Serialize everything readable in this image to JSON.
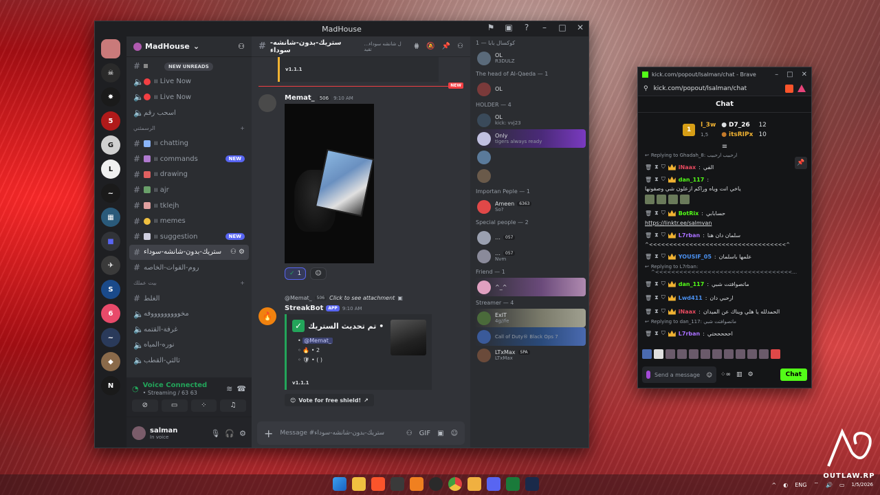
{
  "discord": {
    "window_title": "MadHouse",
    "guild_name": "MadHouse",
    "new_unreads": "NEW UNREADS",
    "channels": [
      {
        "label": "ıı Live Now",
        "badge": ""
      },
      {
        "label": "ıı Live Now",
        "badge": ""
      },
      {
        "label": "اسحب رقم",
        "badge": ""
      }
    ],
    "category1": "الرسمثني",
    "channels2": [
      {
        "label": "ıı chatting",
        "badge": "",
        "color": "#8ab4f8"
      },
      {
        "label": "ıı commands",
        "badge": "NEW",
        "color": "#b07ad0"
      },
      {
        "label": "ıı drawing",
        "badge": "",
        "color": "#e06060"
      },
      {
        "label": "ıı ajr",
        "badge": "",
        "color": "#6aa06a"
      },
      {
        "label": "ıı tklejh",
        "badge": "",
        "color": "#e0a0a0"
      },
      {
        "label": "ıı memes",
        "badge": "",
        "color": "#f0c040"
      },
      {
        "label": "ıı suggestion",
        "badge": "NEW",
        "color": "#d0d0e0"
      },
      {
        "label": "ستريك-بدون-شانشه-سوداء",
        "badge": "",
        "color": ""
      },
      {
        "label": "روم-القوات-الخاصه",
        "badge": "",
        "color": ""
      }
    ],
    "category2": "بيت عملك",
    "channels3": [
      {
        "label": "الغلط"
      },
      {
        "label": "مخوووووووووفه"
      },
      {
        "label": "غرفة-القتمه"
      },
      {
        "label": "نوره-المياه"
      },
      {
        "label": "ثالثي-القطب"
      }
    ],
    "voice": {
      "title": "Voice Connected",
      "sub": "• Streaming / 63 63"
    },
    "user": {
      "name": "salman",
      "status": "In voice"
    },
    "chat_header": {
      "channel": "ستريك-بدون-شانشه-سوداء",
      "topic": "…ل شانشه سوداء تقيد"
    },
    "version_text": "v1.1.1",
    "new_label": "NEW",
    "message1": {
      "author": "Memat_",
      "badge": "506",
      "time": "9:10 AM"
    },
    "reaction": {
      "emoji": "✓",
      "count": "1"
    },
    "reply": {
      "user": "@Memat_",
      "badge": "506",
      "text": "Click to see attachment"
    },
    "bot": {
      "author": "StreakBot",
      "app_tag": "APP",
      "time": "9:10 AM"
    },
    "embed": {
      "title": "تم تحديث الستريك •",
      "mention": "@Memat_",
      "line1": "• 2",
      "line2": "• (   )",
      "version": "v1.1.1"
    },
    "vote_label": "Vote for free shield!",
    "composer_placeholder": "Message #ستريك-بدون-شانشه-سوداء",
    "member_groups": [
      {
        "title": "كوكسال بابا — 1",
        "members": [
          {
            "name": "OL",
            "sub": "R3DULZ",
            "tag": "",
            "style": ""
          }
        ]
      },
      {
        "title": "The head of Al-Qaeda — 1",
        "members": [
          {
            "name": "OL",
            "sub": "",
            "tag": "",
            "style": ""
          }
        ]
      },
      {
        "title": "HOLDER — 4",
        "members": [
          {
            "name": "OL",
            "sub": "kick: vvj23",
            "tag": "",
            "style": ""
          },
          {
            "name": "Only",
            "sub": "tigers always ready",
            "tag": "",
            "style": "hl"
          },
          {
            "name": "",
            "sub": "",
            "tag": "",
            "style": ""
          },
          {
            "name": "",
            "sub": "",
            "tag": "",
            "style": ""
          }
        ]
      },
      {
        "title": "Importan Peple — 1",
        "members": [
          {
            "name": "Ameen",
            "sub": "So?",
            "tag": "6363",
            "style": ""
          }
        ]
      },
      {
        "title": "Special people — 2",
        "members": [
          {
            "name": "…",
            "sub": "",
            "tag": "057",
            "style": ""
          },
          {
            "name": "…",
            "sub": "Nvm",
            "tag": "057",
            "style": ""
          }
        ]
      },
      {
        "title": "Friend — 1",
        "members": [
          {
            "name": "^_^",
            "sub": "",
            "tag": "",
            "style": "hl2"
          }
        ]
      },
      {
        "title": "Streamer — 4",
        "members": [
          {
            "name": "ExIT",
            "sub": "4g//fe",
            "tag": "",
            "style": "hl3"
          },
          {
            "name": "",
            "sub": "Call of Duty® Black Ops 7",
            "tag": "",
            "style": "hl4"
          },
          {
            "name": "LTxMax",
            "sub": "LTxMax",
            "tag": "SPA",
            "style": ""
          }
        ]
      }
    ]
  },
  "kick": {
    "window_title": "kick.com/popout/lsalman/chat - Brave",
    "url": "kick.com/popout/lsalman/chat",
    "header": "Chat",
    "leaders": {
      "first": "l_3w",
      "first_count": "1,5",
      "second": "D7_26",
      "second_count": "12",
      "third": "itsRIPx",
      "third_count": "10"
    },
    "messages": [
      {
        "reply": "Replying to Ghadah_8: ارحبيب ارحبيب",
        "user": "iNaax",
        "color": "#e84a5f",
        "text": "الفي"
      },
      {
        "reply": "",
        "user": "dan_117",
        "color": "#53fc18",
        "text": "ياخي انت وياه وراكم ازعلون شي وصفونها",
        "emotes": 4
      },
      {
        "reply": "",
        "user": "BotRix",
        "color": "#53fc18",
        "text": "حسابابي",
        "link": "https://linktr.ee/salmvan"
      },
      {
        "reply": "",
        "user": "L7rban",
        "color": "#a970ff",
        "text": "سلمان دان هنا",
        "extra": "^<<<<<<<<<<<<<<<<<<<<<<<<<<<<<<<<<<^"
      },
      {
        "reply": "",
        "user": "YOUSIF_05",
        "color": "#4a90f0",
        "text": "علمها باسلمان"
      },
      {
        "reply": "Replying to L7rban: ^<<<<<<<<<<<<<<<<<<<<<<<<<<<<<<<<<<…",
        "user": "dan_117",
        "color": "#53fc18",
        "text": "ماتصوافتت شبي"
      },
      {
        "reply": "",
        "user": "Lwd411",
        "color": "#4a90f0",
        "text": "ارحبي دان"
      },
      {
        "reply": "",
        "user": "iNaax",
        "color": "#e84a5f",
        "text": "الحمدلله يا هلي ويناك عن الميدان"
      },
      {
        "reply": "Replying to dan_117: ماتصوافتت شبي",
        "user": "L7rban",
        "color": "#a970ff",
        "text": "احححححتي"
      }
    ],
    "input_placeholder": "Send a message",
    "chat_button": "Chat"
  },
  "taskbar": {
    "lang": "ENG",
    "time": "",
    "date": "1/5/2026"
  },
  "watermark": "OUTLAW.RP"
}
